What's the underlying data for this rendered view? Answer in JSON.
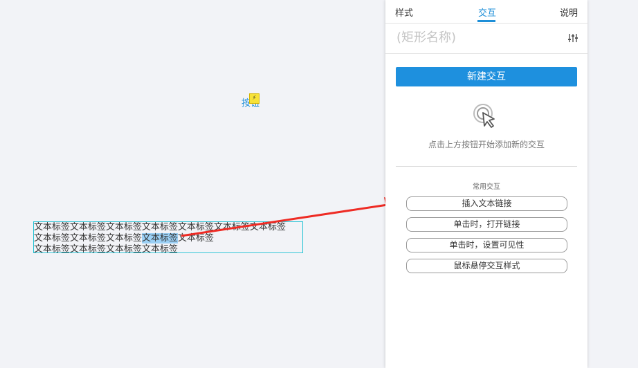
{
  "canvas": {
    "button_widget_label": "按钮",
    "button_badge": "⚡",
    "text_label_lines": [
      "文本标签文本标签文本标签文本标签文本标签文本标签文本标签",
      "文本标签文本标签文本标签",
      "文本标签",
      "文本标签文本标签文本标签文本标签"
    ],
    "arrow_color": "#ee2b24",
    "selection_color": "#9bd0f5",
    "widget_border_color": "#2fc5d6"
  },
  "panel": {
    "tabs": [
      {
        "label": "样式"
      },
      {
        "label": "交互"
      },
      {
        "label": "说明"
      }
    ],
    "active_tab": "交互",
    "name_placeholder": "(矩形名称)",
    "new_interaction_label": "新建交互",
    "empty_hint": "点击上方按钮开始添加新的交互",
    "common_title": "常用交互",
    "common_items": [
      {
        "label": "插入文本链接"
      },
      {
        "label": "单击时，打开链接"
      },
      {
        "label": "单击时，设置可见性"
      },
      {
        "label": "鼠标悬停交互样式"
      }
    ],
    "accent_color": "#1e90de"
  }
}
